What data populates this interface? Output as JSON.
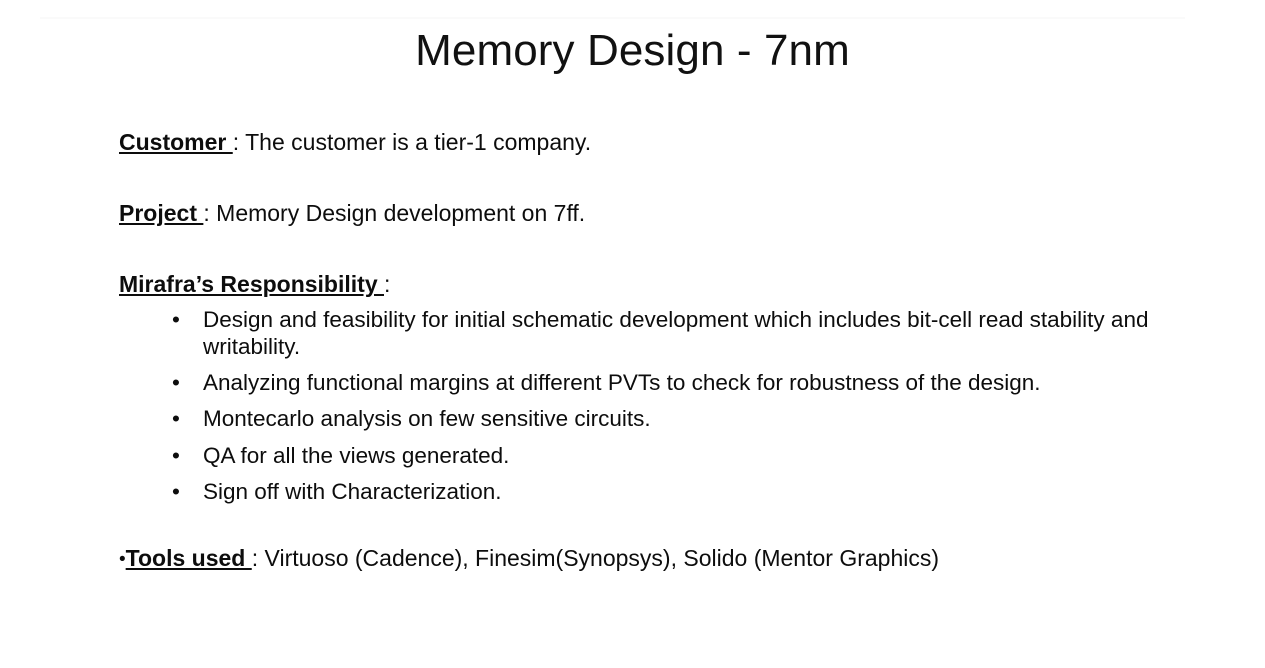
{
  "slide": {
    "title": "Memory Design - 7nm",
    "background_color": "#ffffff",
    "text_color": "#0d0d0d",
    "rule_color": "#fafafa"
  },
  "sections": {
    "customer": {
      "label": "Customer ",
      "separator": ": ",
      "text": "The customer is a tier-1 company."
    },
    "project": {
      "label": "Project ",
      "separator": ": ",
      "text": "Memory Design development on 7ff."
    },
    "responsibility": {
      "label": "Mirafra’s Responsibility ",
      "separator": ":",
      "bullet_glyph": "•",
      "items": [
        "Design and feasibility for initial schematic development which includes bit-cell read stability and writability.",
        "Analyzing functional margins at different PVTs to check for robustness of the design.",
        "Montecarlo analysis on few sensitive circuits.",
        "QA for all the views generated.",
        "Sign off with Characterization."
      ]
    },
    "tools": {
      "bullet_glyph": "•",
      "label": "Tools used ",
      "separator": ": ",
      "text": "Virtuoso (Cadence), Finesim(Synopsys), Solido (Mentor Graphics)"
    }
  }
}
